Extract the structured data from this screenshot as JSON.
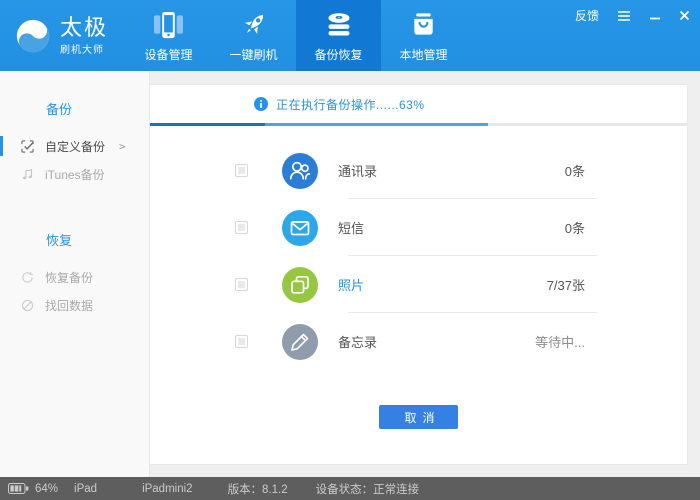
{
  "window": {
    "feedback_label": "反馈"
  },
  "brand": {
    "name": "太极",
    "subtitle": "刷机大师"
  },
  "nav": {
    "tabs": [
      {
        "label": "设备管理",
        "icon": "phone-icon",
        "active": false
      },
      {
        "label": "一键刷机",
        "icon": "rocket-icon",
        "active": false
      },
      {
        "label": "备份恢复",
        "icon": "database-icon",
        "active": true
      },
      {
        "label": "本地管理",
        "icon": "bag-icon",
        "active": false
      }
    ]
  },
  "sidebar": {
    "sections": [
      {
        "title": "备份",
        "items": [
          {
            "label": "自定义备份",
            "icon": "checkbox-check-icon",
            "active": true,
            "arrow": ">"
          },
          {
            "label": "iTunes备份",
            "icon": "music-note-icon",
            "active": false
          }
        ]
      },
      {
        "title": "恢复",
        "items": [
          {
            "label": "恢复备份",
            "icon": "restore-circle-icon",
            "active": false
          },
          {
            "label": "找回数据",
            "icon": "recover-circle-icon",
            "active": false
          }
        ]
      }
    ]
  },
  "main": {
    "progress": {
      "status_text": "正在执行备份操作......63%",
      "fill_percent": 63,
      "dark_fill_percent": 21.5
    },
    "rows": [
      {
        "label": "通讯录",
        "value": "0条",
        "icon": "contacts-icon",
        "icon_color": "#2b7ed6",
        "checked": false
      },
      {
        "label": "短信",
        "value": "0条",
        "icon": "message-icon",
        "icon_color": "#2ba7ea",
        "checked": false
      },
      {
        "label": "照片",
        "value": "7/37张",
        "icon": "photos-icon",
        "icon_color": "#95c840",
        "checked": false,
        "in_progress": true
      },
      {
        "label": "备忘录",
        "value": "等待中...",
        "icon": "memo-icon",
        "icon_color": "#8f9cab",
        "checked": false
      }
    ],
    "cancel_label": "取消"
  },
  "statusbar": {
    "battery_percent": "64%",
    "device_type": "iPad",
    "device_name": "iPadmini2",
    "version": "版本：8.1.2",
    "connection": "设备状态：正常连接"
  },
  "colors": {
    "header_blue": "#2392e4",
    "active_tab_blue": "#1179d3",
    "accent_blue": "#2693e6",
    "progress_dark": "#1d6fc2",
    "progress_light": "#4aa5e0",
    "cancel_blue": "#3480e3",
    "statusbar_gray": "#5e5e5e"
  }
}
